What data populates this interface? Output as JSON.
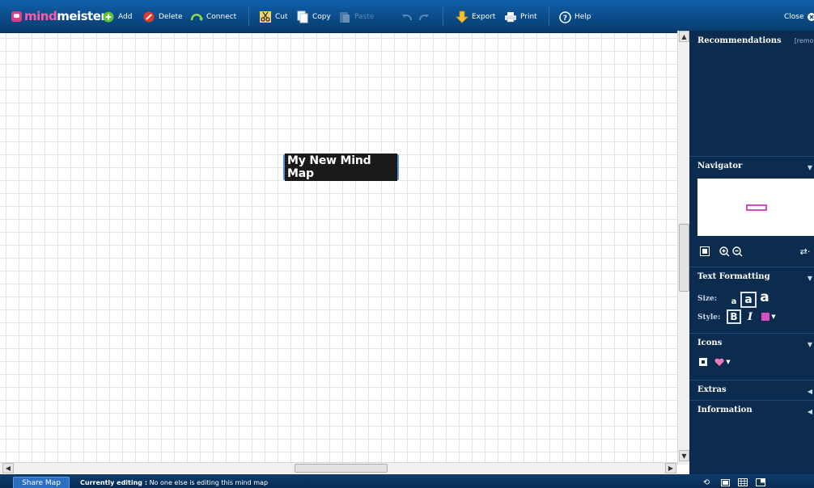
{
  "app": {
    "logo_mind": "mind",
    "logo_meister": "meister"
  },
  "toolbar": {
    "add": "Add",
    "delete": "Delete",
    "connect": "Connect",
    "cut": "Cut",
    "copy": "Copy",
    "paste": "Paste",
    "export": "Export",
    "print": "Print",
    "help": "Help",
    "close": "Close"
  },
  "canvas": {
    "root_node": "My New Mind Map"
  },
  "sidebar": {
    "recommendations": {
      "title": "Recommendations",
      "extra": "[remove"
    },
    "navigator": {
      "title": "Navigator"
    },
    "text_formatting": {
      "title": "Text Formatting",
      "size_label": "Size:",
      "sizes": [
        "a",
        "a",
        "a"
      ],
      "style_label": "Style:",
      "bold": "B",
      "italic": "I"
    },
    "icons": {
      "title": "Icons"
    },
    "extras": {
      "title": "Extras"
    },
    "information": {
      "title": "Information"
    }
  },
  "statusbar": {
    "share": "Share Map",
    "editing_label": "Currently editing :",
    "editing_text": "No one else is editing this mind map"
  },
  "colors": {
    "toolbar": "#0a4a86",
    "sidebar": "#0b2c4f",
    "node_fill": "#7cb3f5",
    "accent_pink": "#e03c8a"
  }
}
